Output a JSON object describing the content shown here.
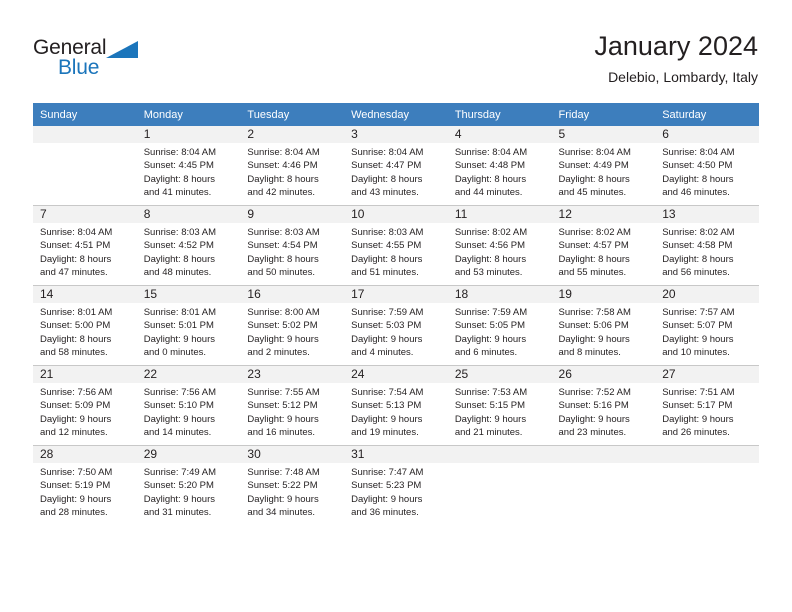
{
  "brand": {
    "name_part1": "General",
    "name_part2": "Blue",
    "accent_color": "#1b75bb",
    "triangle_icon": "triangle-icon"
  },
  "header": {
    "title": "January 2024",
    "location": "Delebio, Lombardy, Italy"
  },
  "calendar": {
    "header_background": "#3d7ebd",
    "weekday_headers": [
      "Sunday",
      "Monday",
      "Tuesday",
      "Wednesday",
      "Thursday",
      "Friday",
      "Saturday"
    ],
    "weeks": [
      [
        {
          "day": "",
          "lines": []
        },
        {
          "day": "1",
          "lines": [
            "Sunrise: 8:04 AM",
            "Sunset: 4:45 PM",
            "Daylight: 8 hours",
            "and 41 minutes."
          ]
        },
        {
          "day": "2",
          "lines": [
            "Sunrise: 8:04 AM",
            "Sunset: 4:46 PM",
            "Daylight: 8 hours",
            "and 42 minutes."
          ]
        },
        {
          "day": "3",
          "lines": [
            "Sunrise: 8:04 AM",
            "Sunset: 4:47 PM",
            "Daylight: 8 hours",
            "and 43 minutes."
          ]
        },
        {
          "day": "4",
          "lines": [
            "Sunrise: 8:04 AM",
            "Sunset: 4:48 PM",
            "Daylight: 8 hours",
            "and 44 minutes."
          ]
        },
        {
          "day": "5",
          "lines": [
            "Sunrise: 8:04 AM",
            "Sunset: 4:49 PM",
            "Daylight: 8 hours",
            "and 45 minutes."
          ]
        },
        {
          "day": "6",
          "lines": [
            "Sunrise: 8:04 AM",
            "Sunset: 4:50 PM",
            "Daylight: 8 hours",
            "and 46 minutes."
          ]
        }
      ],
      [
        {
          "day": "7",
          "lines": [
            "Sunrise: 8:04 AM",
            "Sunset: 4:51 PM",
            "Daylight: 8 hours",
            "and 47 minutes."
          ]
        },
        {
          "day": "8",
          "lines": [
            "Sunrise: 8:03 AM",
            "Sunset: 4:52 PM",
            "Daylight: 8 hours",
            "and 48 minutes."
          ]
        },
        {
          "day": "9",
          "lines": [
            "Sunrise: 8:03 AM",
            "Sunset: 4:54 PM",
            "Daylight: 8 hours",
            "and 50 minutes."
          ]
        },
        {
          "day": "10",
          "lines": [
            "Sunrise: 8:03 AM",
            "Sunset: 4:55 PM",
            "Daylight: 8 hours",
            "and 51 minutes."
          ]
        },
        {
          "day": "11",
          "lines": [
            "Sunrise: 8:02 AM",
            "Sunset: 4:56 PM",
            "Daylight: 8 hours",
            "and 53 minutes."
          ]
        },
        {
          "day": "12",
          "lines": [
            "Sunrise: 8:02 AM",
            "Sunset: 4:57 PM",
            "Daylight: 8 hours",
            "and 55 minutes."
          ]
        },
        {
          "day": "13",
          "lines": [
            "Sunrise: 8:02 AM",
            "Sunset: 4:58 PM",
            "Daylight: 8 hours",
            "and 56 minutes."
          ]
        }
      ],
      [
        {
          "day": "14",
          "lines": [
            "Sunrise: 8:01 AM",
            "Sunset: 5:00 PM",
            "Daylight: 8 hours",
            "and 58 minutes."
          ]
        },
        {
          "day": "15",
          "lines": [
            "Sunrise: 8:01 AM",
            "Sunset: 5:01 PM",
            "Daylight: 9 hours",
            "and 0 minutes."
          ]
        },
        {
          "day": "16",
          "lines": [
            "Sunrise: 8:00 AM",
            "Sunset: 5:02 PM",
            "Daylight: 9 hours",
            "and 2 minutes."
          ]
        },
        {
          "day": "17",
          "lines": [
            "Sunrise: 7:59 AM",
            "Sunset: 5:03 PM",
            "Daylight: 9 hours",
            "and 4 minutes."
          ]
        },
        {
          "day": "18",
          "lines": [
            "Sunrise: 7:59 AM",
            "Sunset: 5:05 PM",
            "Daylight: 9 hours",
            "and 6 minutes."
          ]
        },
        {
          "day": "19",
          "lines": [
            "Sunrise: 7:58 AM",
            "Sunset: 5:06 PM",
            "Daylight: 9 hours",
            "and 8 minutes."
          ]
        },
        {
          "day": "20",
          "lines": [
            "Sunrise: 7:57 AM",
            "Sunset: 5:07 PM",
            "Daylight: 9 hours",
            "and 10 minutes."
          ]
        }
      ],
      [
        {
          "day": "21",
          "lines": [
            "Sunrise: 7:56 AM",
            "Sunset: 5:09 PM",
            "Daylight: 9 hours",
            "and 12 minutes."
          ]
        },
        {
          "day": "22",
          "lines": [
            "Sunrise: 7:56 AM",
            "Sunset: 5:10 PM",
            "Daylight: 9 hours",
            "and 14 minutes."
          ]
        },
        {
          "day": "23",
          "lines": [
            "Sunrise: 7:55 AM",
            "Sunset: 5:12 PM",
            "Daylight: 9 hours",
            "and 16 minutes."
          ]
        },
        {
          "day": "24",
          "lines": [
            "Sunrise: 7:54 AM",
            "Sunset: 5:13 PM",
            "Daylight: 9 hours",
            "and 19 minutes."
          ]
        },
        {
          "day": "25",
          "lines": [
            "Sunrise: 7:53 AM",
            "Sunset: 5:15 PM",
            "Daylight: 9 hours",
            "and 21 minutes."
          ]
        },
        {
          "day": "26",
          "lines": [
            "Sunrise: 7:52 AM",
            "Sunset: 5:16 PM",
            "Daylight: 9 hours",
            "and 23 minutes."
          ]
        },
        {
          "day": "27",
          "lines": [
            "Sunrise: 7:51 AM",
            "Sunset: 5:17 PM",
            "Daylight: 9 hours",
            "and 26 minutes."
          ]
        }
      ],
      [
        {
          "day": "28",
          "lines": [
            "Sunrise: 7:50 AM",
            "Sunset: 5:19 PM",
            "Daylight: 9 hours",
            "and 28 minutes."
          ]
        },
        {
          "day": "29",
          "lines": [
            "Sunrise: 7:49 AM",
            "Sunset: 5:20 PM",
            "Daylight: 9 hours",
            "and 31 minutes."
          ]
        },
        {
          "day": "30",
          "lines": [
            "Sunrise: 7:48 AM",
            "Sunset: 5:22 PM",
            "Daylight: 9 hours",
            "and 34 minutes."
          ]
        },
        {
          "day": "31",
          "lines": [
            "Sunrise: 7:47 AM",
            "Sunset: 5:23 PM",
            "Daylight: 9 hours",
            "and 36 minutes."
          ]
        },
        {
          "day": "",
          "lines": []
        },
        {
          "day": "",
          "lines": []
        },
        {
          "day": "",
          "lines": []
        }
      ]
    ]
  }
}
